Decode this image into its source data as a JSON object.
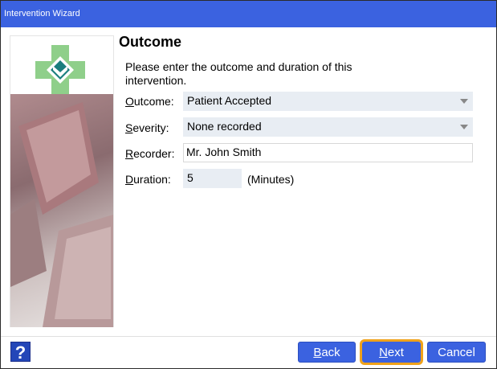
{
  "window": {
    "title": "Intervention Wizard"
  },
  "page": {
    "heading": "Outcome",
    "description": "Please enter the outcome and duration of this intervention."
  },
  "form": {
    "outcome": {
      "label_first": "O",
      "label_rest": "utcome:",
      "value": "Patient Accepted"
    },
    "severity": {
      "label_first": "S",
      "label_rest": "everity:",
      "value": "None recorded"
    },
    "recorder": {
      "label_first": "R",
      "label_rest": "ecorder:",
      "value": "Mr. John Smith"
    },
    "duration": {
      "label_first": "D",
      "label_rest": "uration:",
      "value": "5",
      "unit": "(Minutes)"
    }
  },
  "buttons": {
    "help": "?",
    "back": {
      "first": "B",
      "rest": "ack"
    },
    "next": {
      "first": "N",
      "rest": "ext"
    },
    "cancel": "Cancel"
  },
  "icons": {
    "logo": "green-cross-logo-icon",
    "help": "help-question-icon",
    "dropdown": "chevron-down-icon"
  },
  "colors": {
    "titlebar": "#3b62e0",
    "button": "#3b62e0",
    "focus_outline": "#f0a21a",
    "logo_green": "#8fcf8a",
    "logo_teal": "#1a7e7e"
  }
}
